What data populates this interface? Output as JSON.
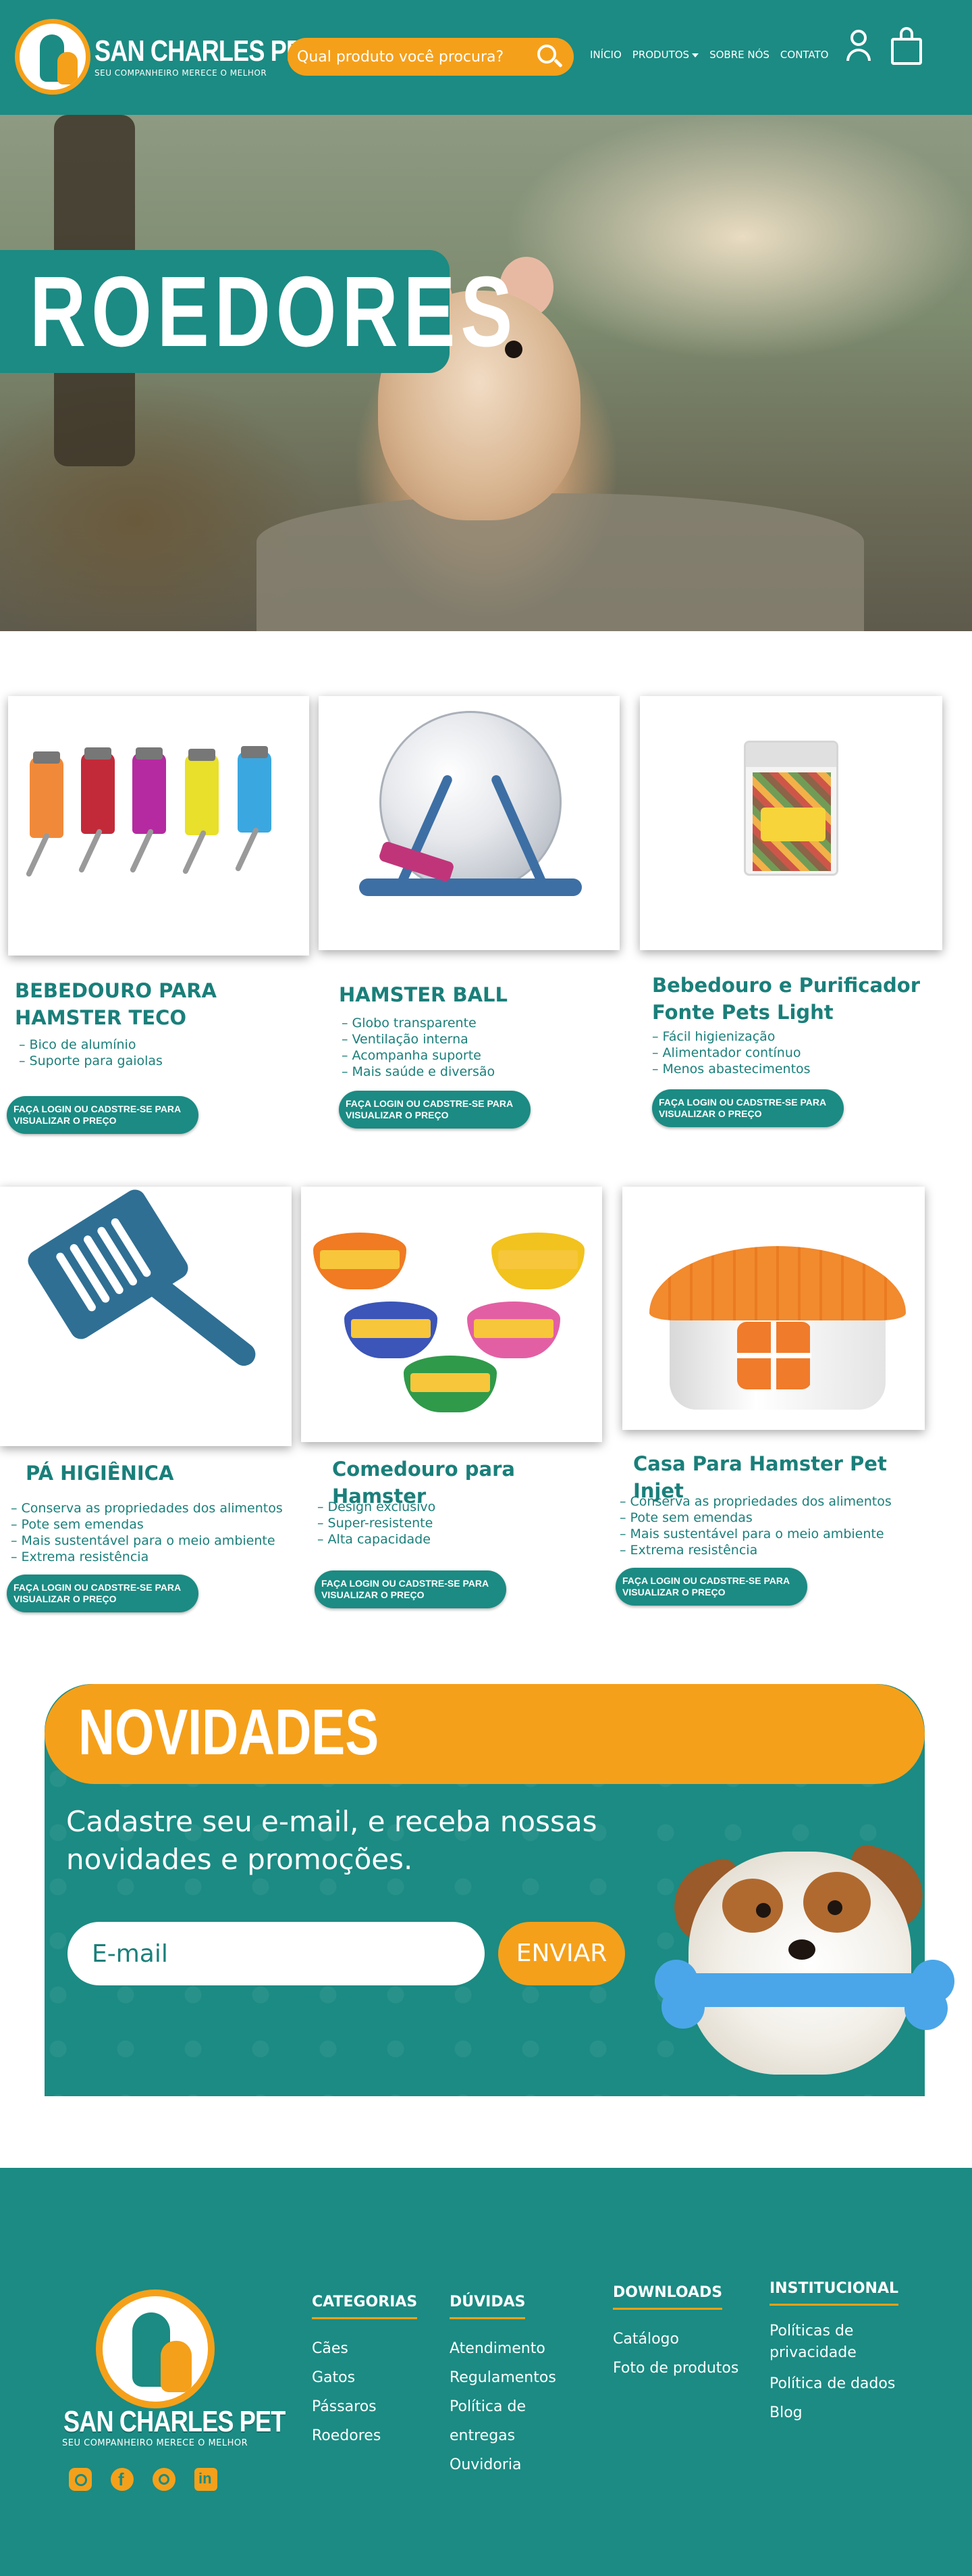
{
  "brand": {
    "name": "SAN CHARLES PET",
    "slogan": "SEU COMPANHEIRO MERECE O MELHOR"
  },
  "header": {
    "search_placeholder": "Qual produto você procura?",
    "nav": {
      "home": "INÍCIO",
      "products": "PRODUTOS",
      "about": "SOBRE NÓS",
      "contact": "CONTATO"
    }
  },
  "hero": {
    "title": "ROEDORES"
  },
  "products": [
    {
      "title": "BEBEDOURO PARA HAMSTER TECO",
      "features": [
        "– Bico de alumínio",
        "– Suporte para gaiolas"
      ],
      "cta": "FAÇA LOGIN OU CADSTRE-SE PARA\nVISUALIZAR O PREÇO"
    },
    {
      "title": "HAMSTER BALL",
      "features": [
        "– Globo transparente",
        "– Ventilação interna",
        "– Acompanha suporte",
        "– Mais saúde e diversão"
      ],
      "cta": "FAÇA LOGIN OU CADSTRE-SE PARA\nVISUALIZAR O PREÇO"
    },
    {
      "title": "Bebedouro e Purificador Fonte Pets Light",
      "features": [
        "– Fácil higienização",
        "– Alimentador contínuo",
        "– Menos abastecimentos"
      ],
      "cta": "FAÇA LOGIN OU CADSTRE-SE PARA\nVISUALIZAR O PREÇO"
    },
    {
      "title": "PÁ HIGIÊNICA",
      "features": [
        "– Conserva as propriedades dos alimentos",
        "– Pote sem emendas",
        "– Mais sustentável para o meio ambiente",
        "– Extrema resistência"
      ],
      "cta": "FAÇA LOGIN OU CADSTRE-SE PARA\nVISUALIZAR O PREÇO"
    },
    {
      "title": "Comedouro para Hamster",
      "features": [
        "– Design exclusivo",
        "– Super-resistente",
        "– Alta capacidade"
      ],
      "cta": "FAÇA LOGIN OU CADSTRE-SE PARA\nVISUALIZAR O PREÇO"
    },
    {
      "title": "Casa Para Hamster Pet Injet",
      "features": [
        "– Conserva as propriedades dos alimentos",
        "– Pote sem emendas",
        "– Mais sustentável para o meio ambiente",
        "– Extrema resistência"
      ],
      "cta": "FAÇA LOGIN OU CADSTRE-SE PARA\nVISUALIZAR O PREÇO"
    }
  ],
  "newsletter": {
    "title": "NOVIDADES",
    "text": "Cadastre seu e-mail, e receba nossas novidades e promoções.",
    "email_placeholder": "E-mail",
    "button": "ENVIAR"
  },
  "footer": {
    "columns": [
      {
        "title": "CATEGORIAS",
        "links": [
          "Cães",
          "Gatos",
          "Pássaros",
          "Roedores"
        ]
      },
      {
        "title": "DÚVIDAS",
        "links": [
          "Atendimento",
          "Regulamentos",
          "Política de entregas",
          "Ouvidoria"
        ]
      },
      {
        "title": "DOWNLOADS",
        "links": [
          "Catálogo",
          "Foto de produtos"
        ]
      },
      {
        "title": "INSTITUCIONAL",
        "links": [
          "Políticas de privacidade",
          "Política de dados",
          "Blog"
        ]
      }
    ]
  },
  "colors": {
    "teal": "#1b8b83",
    "orange": "#f5a01a",
    "text_teal": "#1a7f7a",
    "white": "#ffffff"
  },
  "icons": [
    "search-icon",
    "user-icon",
    "shopping-bag-icon",
    "instagram-icon",
    "facebook-icon",
    "whatsapp-icon",
    "linkedin-icon"
  ]
}
